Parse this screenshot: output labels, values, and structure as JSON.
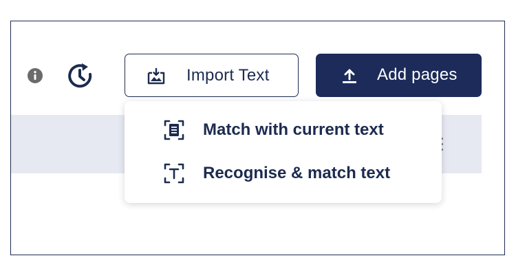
{
  "toolbar": {
    "info_icon": "info-icon",
    "history_icon": "history-icon",
    "import_button": {
      "label": "Import Text",
      "icon": "image-import-icon"
    },
    "add_pages_button": {
      "label": "Add pages",
      "icon": "upload-icon"
    }
  },
  "import_menu": {
    "items": [
      {
        "label": "Match with current text",
        "icon": "document-scan-icon"
      },
      {
        "label": "Recognise & match text",
        "icon": "text-recognition-icon"
      }
    ]
  },
  "colors": {
    "primary": "#1c2b5a",
    "text": "#1c2b4f",
    "band": "#e6e9f1",
    "info_grey": "#6b6b6b"
  }
}
